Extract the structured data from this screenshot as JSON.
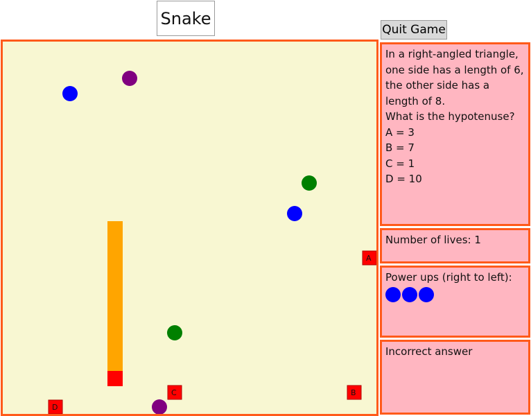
{
  "title": "Snake",
  "quit_button": "Quit Game",
  "question": {
    "lines": [
      "In a right-angled triangle, one side has a length of 6, the other side has a length of 8.",
      "What is the hypotenuse?",
      "A = 3",
      "B = 7",
      "C = 1",
      "D = 10"
    ]
  },
  "lives": {
    "text": "Number of lives: 1"
  },
  "powerups": {
    "label": "Power ups (right to left):",
    "count": 3,
    "color": "#0000ff"
  },
  "feedback": {
    "text": "Incorrect answer"
  },
  "answer_boxes": {
    "A": "A",
    "B": "B",
    "C": "C",
    "D": "D"
  },
  "colors": {
    "board_bg": "#f8f7d2",
    "border": "#ff5a1a",
    "panel_bg": "#ffb6c1",
    "snake_body": "#ffa500",
    "snake_head": "#ff0000",
    "answer_box": "#ff0000",
    "dot_blue": "#0000ff",
    "dot_purple": "#800080",
    "dot_green": "#008000"
  }
}
